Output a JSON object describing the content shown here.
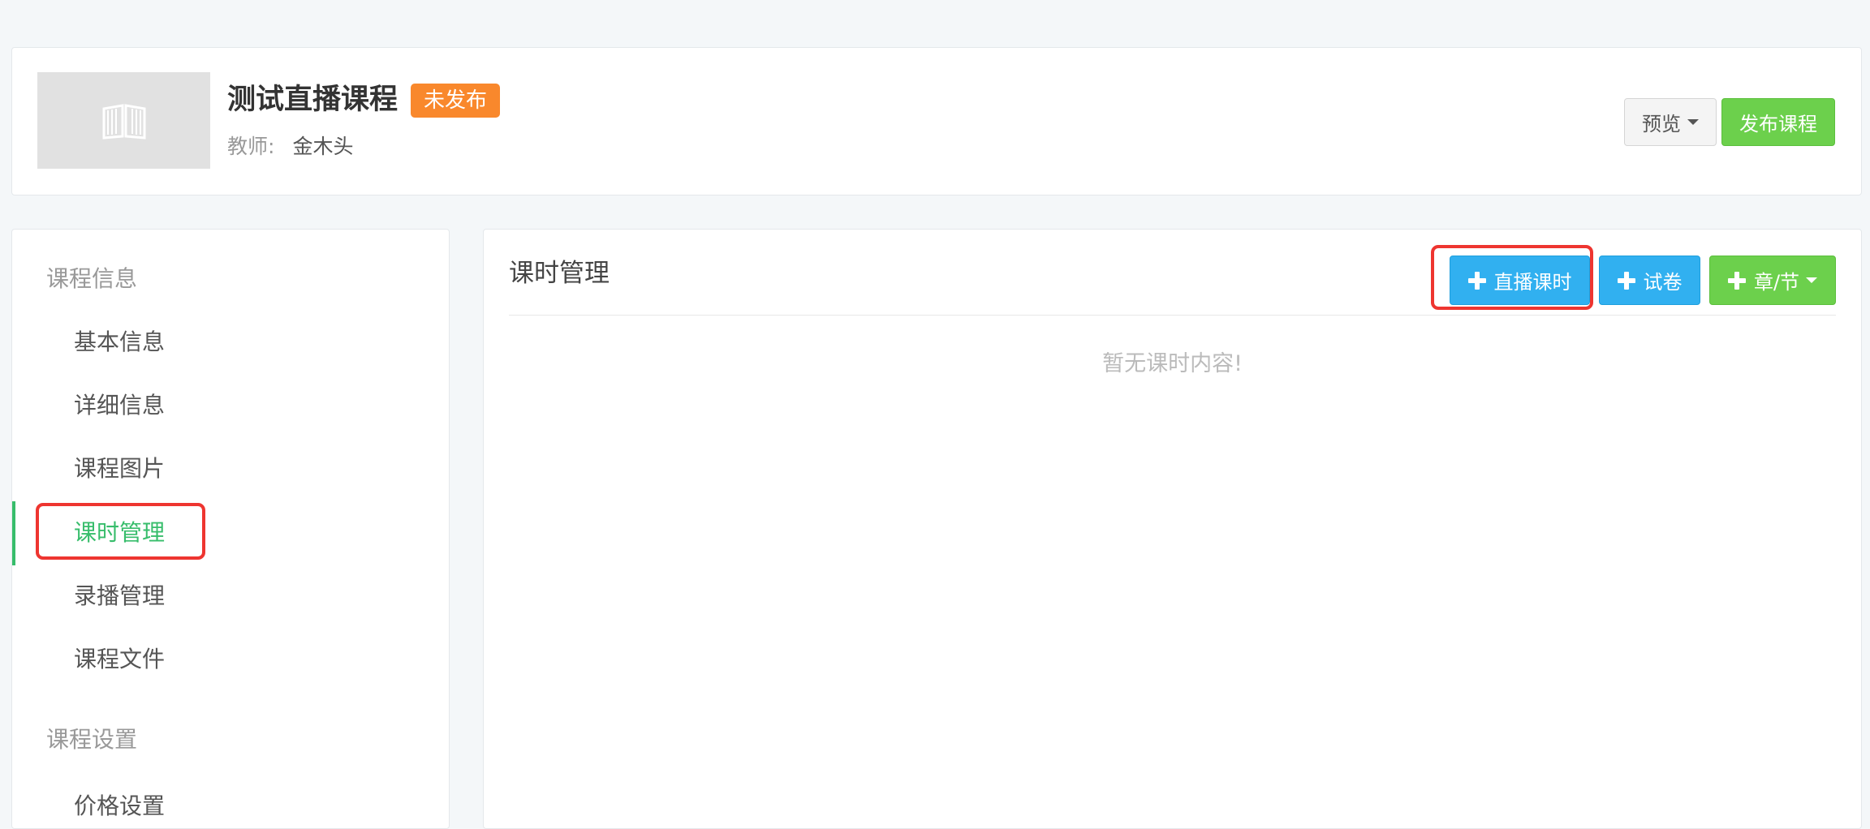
{
  "header": {
    "course_title": "测试直播课程",
    "status_badge": "未发布",
    "teacher_label": "教师:",
    "teacher_name": "金木头",
    "preview_label": "预览",
    "publish_label": "发布课程",
    "cover_icon": "book-icon"
  },
  "sidebar": {
    "groups": [
      {
        "title": "课程信息",
        "items": [
          {
            "label": "基本信息"
          },
          {
            "label": "详细信息"
          },
          {
            "label": "课程图片"
          },
          {
            "label": "课时管理",
            "active": true
          },
          {
            "label": "录播管理"
          },
          {
            "label": "课程文件"
          }
        ]
      },
      {
        "title": "课程设置",
        "items": [
          {
            "label": "价格设置"
          }
        ]
      }
    ]
  },
  "main": {
    "title": "课时管理",
    "buttons": {
      "add_live": "直播课时",
      "add_exam": "试卷",
      "add_chapter": "章/节"
    },
    "empty_text": "暂无课时内容!"
  },
  "colors": {
    "accent_green": "#37bd6b",
    "button_blue": "#31b0f0",
    "button_green": "#6cd04c",
    "badge_orange": "#f9882c",
    "highlight_red": "#ee3530"
  }
}
